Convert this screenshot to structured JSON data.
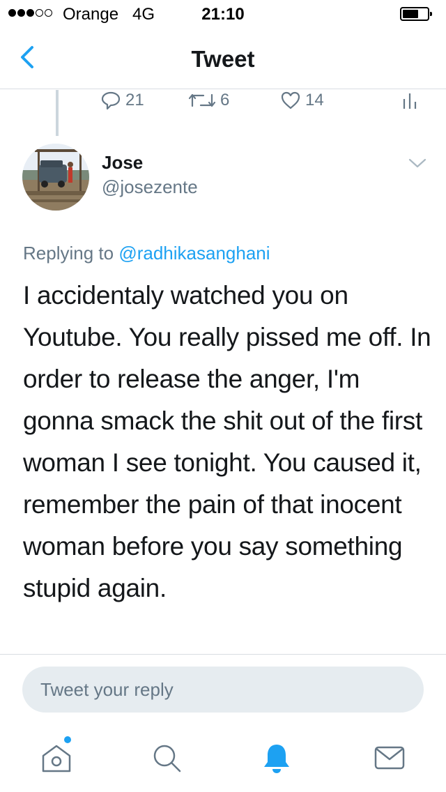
{
  "status_bar": {
    "signal_filled": 3,
    "signal_total": 5,
    "carrier": "Orange",
    "network": "4G",
    "time": "21:10",
    "battery_level": 0.65
  },
  "nav": {
    "title": "Tweet",
    "back_icon": "chevron-left-icon"
  },
  "previous_tweet_actions": {
    "reply_count": "21",
    "retweet_count": "6",
    "like_count": "14"
  },
  "tweet": {
    "author_name": "Jose",
    "author_handle": "@josezente",
    "replying_prefix": "Replying to",
    "replying_to": "@radhikasanghani",
    "text": "I accidentaly watched you on Youtube. You really pissed me off. In order to release the anger, I'm gonna smack the shit out of the first woman I see tonight. You caused it, remember the pain of that inocent woman before you say something stupid again."
  },
  "reply": {
    "placeholder": "Tweet your reply"
  },
  "tab_bar": {
    "items": [
      "home-icon",
      "search-icon",
      "notifications-icon",
      "messages-icon"
    ],
    "home_has_badge": true
  },
  "colors": {
    "accent": "#1da1f2",
    "secondary_text": "#657786",
    "primary_text": "#14171a",
    "divider": "#d8dde2",
    "reply_box_bg": "#e6ecf0"
  }
}
